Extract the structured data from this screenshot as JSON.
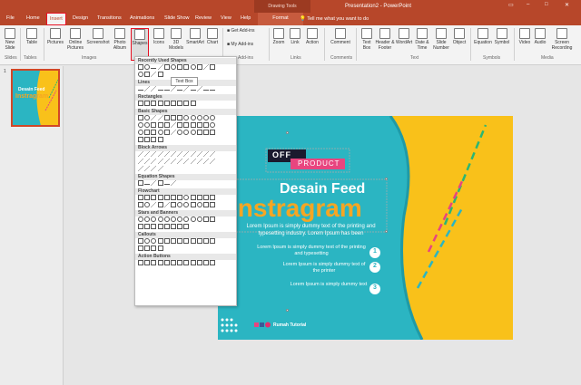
{
  "titlebar": {
    "drawing_tools": "Drawing Tools",
    "doc_title": "Presentation2 - PowerPoint"
  },
  "tabs": [
    "File",
    "Home",
    "Insert",
    "Design",
    "Transitions",
    "Animations",
    "Slide Show",
    "Review",
    "View",
    "Help",
    "Format"
  ],
  "tell_me": "Tell me what you want to do",
  "ribbon": {
    "new_slide": "New Slide",
    "table": "Table",
    "pictures": "Pictures",
    "online_pictures": "Online Pictures",
    "screenshot": "Screenshot",
    "photo_album": "Photo Album",
    "shapes": "Shapes",
    "icons": "Icons",
    "models_3d": "3D Models",
    "smartart": "SmartArt",
    "chart": "Chart",
    "get_addins": "Get Add-ins",
    "my_addins": "My Add-ins",
    "zoom": "Zoom",
    "link": "Link",
    "action": "Action",
    "comment": "Comment",
    "text_box": "Text Box",
    "header_footer": "Header & Footer",
    "wordart": "WordArt",
    "date_time": "Date & Time",
    "slide_number": "Slide Number",
    "object": "Object",
    "equation": "Equation",
    "symbol": "Symbol",
    "video": "Video",
    "audio": "Audio",
    "screen_recording": "Screen Recording",
    "groups": [
      "Slides",
      "Tables",
      "Images",
      "Add-ins",
      "Links",
      "Comments",
      "Text",
      "Symbols",
      "Media"
    ]
  },
  "shapes_menu": {
    "categories": [
      "Recently Used Shapes",
      "Lines",
      "Rectangles",
      "Basic Shapes",
      "Block Arrows",
      "Equation Shapes",
      "Flowchart",
      "Stars and Banners",
      "Callouts",
      "Action Buttons"
    ],
    "tooltip": "Text Box"
  },
  "thumbnail": {
    "number": "1"
  },
  "slide": {
    "off": "OFF",
    "product": "PRODUCT",
    "title1": "Desain Feed",
    "title2": "Instragram",
    "para": "Lorem Ipsum is simply dummy text of the printing and typesetting industry. Lorem Ipsum has been",
    "item1": "Lorem Ipsum is simply dummy text of the printing and typesetting",
    "item2": "Lorem Ipsum is simply dummy text of the printer",
    "item3": "Lorem Ipsum is simply dummy text",
    "num1": "1",
    "num2": "2",
    "num3": "3",
    "footer": "Rumah Tutorial"
  },
  "colors": {
    "accent": "#b7472a",
    "teal": "#2bb5c2",
    "yellow": "#f9c11a",
    "orange": "#f5a623",
    "pink": "#e8457f",
    "green": "#2bb673"
  }
}
